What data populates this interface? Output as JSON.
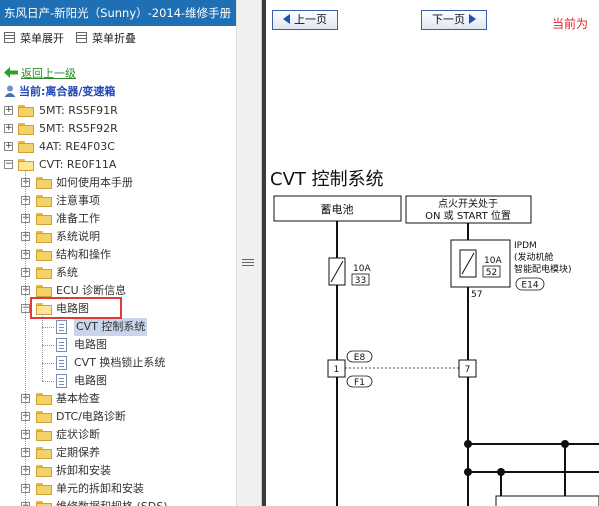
{
  "window": {
    "title": "东风日产-新阳光（Sunny）-2014-维修手册"
  },
  "menu": {
    "expand_label": "菜单展开",
    "collapse_label": "菜单折叠"
  },
  "back_label": "返回上一级",
  "current_label": "当前:离合器/变速箱",
  "tree": {
    "top_items": [
      "5MT: RS5F91R",
      "5MT: RS5F92R",
      "4AT: RE4F03C",
      "CVT: RE0F11A"
    ],
    "cvt_children": [
      "如何使用本手册",
      "注意事项",
      "准备工作",
      "系统说明",
      "结构和操作",
      "系统",
      "ECU 诊断信息",
      "电路图"
    ],
    "circuit_children": [
      "CVT 控制系统",
      "电路图",
      "CVT 换档锁止系统",
      "电路图"
    ],
    "after_items": [
      "基本检查",
      "DTC/电路诊断",
      "症状诊断",
      "定期保养",
      "拆卸和安装",
      "单元的拆卸和安装",
      "维修数据和规格 (SDS)"
    ]
  },
  "nav": {
    "prev_label": "上一页",
    "next_label": "下一页",
    "current_page_label": "当前为"
  },
  "diagram": {
    "title": "CVT 控制系统",
    "battery_label": "蓄电池",
    "ignition_label_1": "点火开关处于",
    "ignition_label_2": "ON 或 START 位置",
    "fuse1_amp": "10A",
    "fuse1_num": "33",
    "fuse2_amp": "10A",
    "fuse2_num": "52",
    "ipdm_name": "IPDM",
    "ipdm_desc_1": "(发动机舱",
    "ipdm_desc_2": "智能配电模块)",
    "wire_57": "57",
    "conn_e14": "E14",
    "conn_e8": "E8",
    "conn_f1": "F1",
    "pin_1": "1",
    "pin_7": "7"
  }
}
